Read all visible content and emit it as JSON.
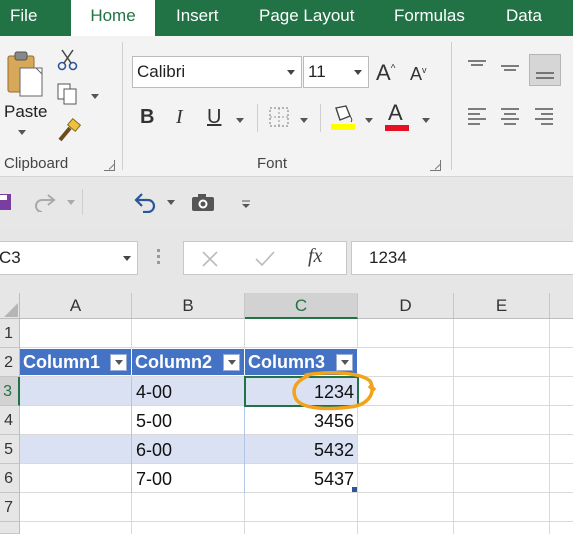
{
  "ribbon_tabs": [
    {
      "label": "File"
    },
    {
      "label": "Home"
    },
    {
      "label": "Insert"
    },
    {
      "label": "Page Layout"
    },
    {
      "label": "Formulas"
    },
    {
      "label": "Data"
    }
  ],
  "active_tab": "Home",
  "clipboard": {
    "paste_label": "Paste",
    "group_label": "Clipboard"
  },
  "font": {
    "name": "Calibri",
    "size": "11",
    "group_label": "Font",
    "bold": "B",
    "italic": "I",
    "underline": "U",
    "grow": "A",
    "shrink": "A",
    "font_color_letter": "A"
  },
  "formula_bar": {
    "name_box": "C3",
    "fx": "fx",
    "content": "1234"
  },
  "columns": [
    "A",
    "B",
    "C",
    "D",
    "E"
  ],
  "rows": [
    "1",
    "2",
    "3",
    "4",
    "5",
    "6",
    "7"
  ],
  "table": {
    "headers": [
      "Column1",
      "Column2",
      "Column3"
    ],
    "rows": [
      {
        "col2": "4-00",
        "col3": "1234"
      },
      {
        "col2": "5-00",
        "col3": "3456"
      },
      {
        "col2": "6-00",
        "col3": "5432"
      },
      {
        "col2": "7-00",
        "col3": "5437"
      }
    ]
  },
  "colors": {
    "excel_green": "#217346",
    "table_header": "#4472c4",
    "table_band": "#d9e1f2",
    "highlight_circle": "#f2a31b",
    "font_color_bar": "#e81123",
    "fill_color_bar": "#ffff00"
  }
}
